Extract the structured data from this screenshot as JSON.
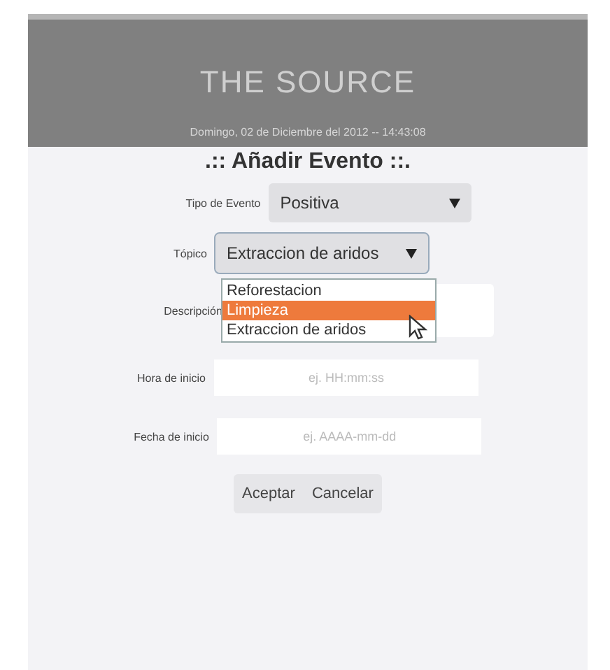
{
  "header": {
    "title": "THE SOURCE",
    "datetime": "Domingo, 02 de Diciembre del 2012 -- 14:43:08"
  },
  "form": {
    "heading": ".:: Añadir Evento ::.",
    "fields": [
      {
        "kind": "select",
        "label": "Tipo de Evento",
        "value": "Positiva",
        "open": false
      },
      {
        "kind": "select",
        "label": "Tópico",
        "value": "Extraccion de aridos",
        "open": true,
        "options": [
          {
            "label": "Reforestacion",
            "highlighted": false
          },
          {
            "label": "Limpieza",
            "highlighted": true
          },
          {
            "label": "Extraccion de aridos",
            "highlighted": false
          }
        ]
      },
      {
        "kind": "textarea",
        "label": "Descripción"
      },
      {
        "kind": "input",
        "label": "Hora de inicio",
        "placeholder": "ej. HH:mm:ss"
      },
      {
        "kind": "input",
        "label": "Fecha de inicio",
        "placeholder": "ej. AAAA-mm-dd"
      }
    ],
    "buttons": [
      "Aceptar",
      "Cancelar"
    ]
  }
}
